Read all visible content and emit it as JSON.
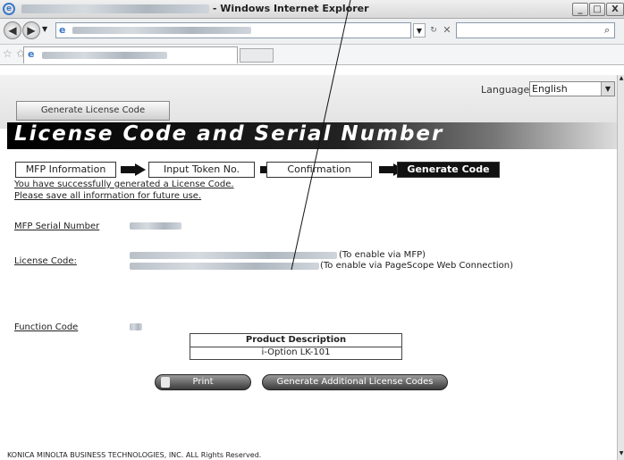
{
  "window": {
    "title_suffix": "- Windows Internet Explorer",
    "minimize": "_",
    "maximize": "□",
    "close": "X"
  },
  "page": {
    "language_label": "Language",
    "language_value": "English",
    "tab_label": "Generate License Code",
    "banner_title": "License Code and Serial Number",
    "steps": [
      "MFP Information",
      "Input Token No.",
      "Confirmation",
      "Generate Code"
    ],
    "messages": [
      "You have successfully generated a License Code.",
      "Please save all information for future use."
    ],
    "mfp_serial_label": "MFP Serial Number",
    "license_code_label": "License Code:",
    "license_note_mfp": "(To enable via MFP)",
    "license_note_web": "(To enable via PageScope Web Connection)",
    "function_code_label": "Function Code",
    "product_header": "Product Description",
    "product_value": "i-Option LK-101",
    "print_button": "Print",
    "generate_button": "Generate Additional License Codes",
    "footer": "KONICA MINOLTA BUSINESS TECHNOLOGIES, INC. ALL Rights Reserved."
  }
}
